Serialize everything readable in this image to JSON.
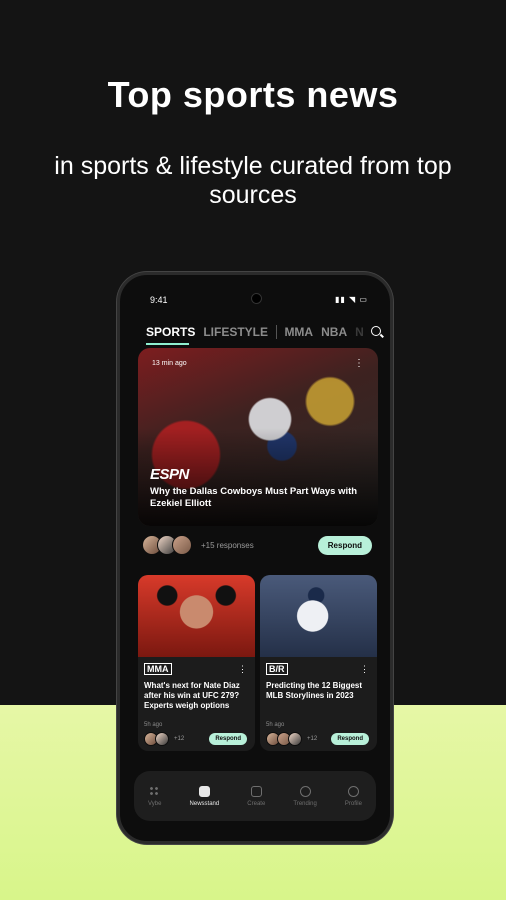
{
  "promo": {
    "headline": "Top sports news",
    "subline": "in sports & lifestyle curated from top sources"
  },
  "status_bar": {
    "time": "9:41",
    "icons": "▮▮ ◥ ▭"
  },
  "tabs": [
    {
      "label": "SPORTS",
      "active": true
    },
    {
      "label": "LIFESTYLE",
      "active": false
    },
    {
      "label": "MMA",
      "active": false
    },
    {
      "label": "NBA",
      "active": false
    },
    {
      "label": "NFL",
      "active": false
    }
  ],
  "hero": {
    "time_ago": "13 min ago",
    "source": "ESPN",
    "title": "Why the Dallas Cowboys Must Part Ways with Ezekiel Elliott",
    "responses": "+15 responses",
    "respond_label": "Respond"
  },
  "cards": [
    {
      "source": "MMA",
      "title": "What's next for Nate Diaz after his win at UFC 279? Experts weigh options",
      "age": "5h ago",
      "count": "+12",
      "respond_label": "Respond"
    },
    {
      "source": "B/R",
      "title": "Predicting the 12 Biggest MLB Storylines in 2023",
      "age": "5h ago",
      "count": "+12",
      "respond_label": "Respond"
    }
  ],
  "nav": [
    {
      "label": "Vybe",
      "icon": "dots-icon",
      "active": false
    },
    {
      "label": "Newsstand",
      "icon": "newsstand-icon",
      "active": true
    },
    {
      "label": "Create",
      "icon": "create-icon",
      "active": false
    },
    {
      "label": "Trending",
      "icon": "trending-icon",
      "active": false
    },
    {
      "label": "Profile",
      "icon": "profile-icon",
      "active": false
    }
  ],
  "colors": {
    "accent": "#b8f0d9",
    "background": "#141414",
    "lime": "#d8f58a"
  }
}
